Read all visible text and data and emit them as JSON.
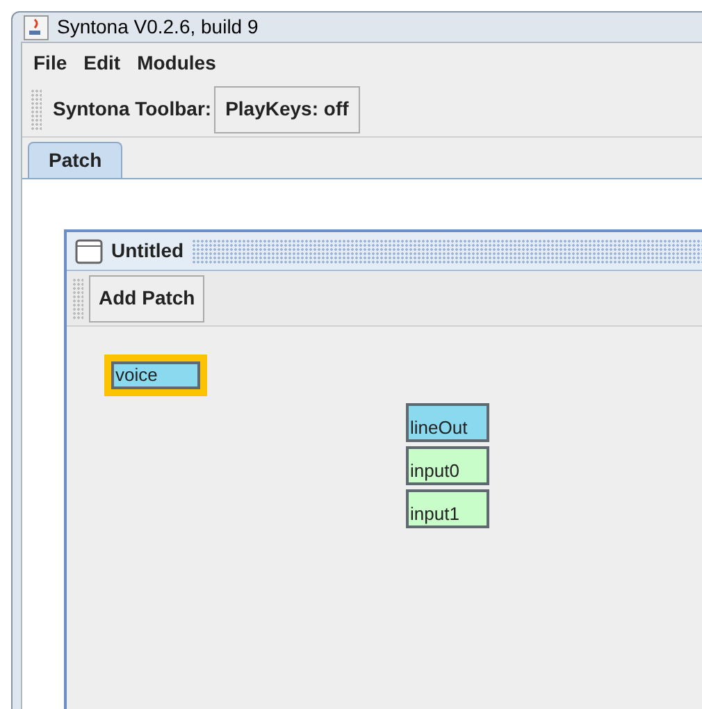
{
  "window": {
    "title": "Syntona V0.2.6, build 9"
  },
  "menu": [
    "File",
    "Edit",
    "Modules"
  ],
  "toolbar": {
    "label": "Syntona Toolbar:",
    "button": "PlayKeys: off"
  },
  "tabs": [
    {
      "label": "Patch",
      "selected": true
    }
  ],
  "internal_frame": {
    "title": "Untitled",
    "toolbar_button": "Add Patch"
  },
  "nodes": [
    {
      "label": "voice",
      "kind": "module",
      "selected": true
    },
    {
      "label": "lineOut",
      "kind": "module",
      "selected": false
    },
    {
      "label": "input0",
      "kind": "input",
      "selected": false
    },
    {
      "label": "input1",
      "kind": "input",
      "selected": false
    }
  ]
}
